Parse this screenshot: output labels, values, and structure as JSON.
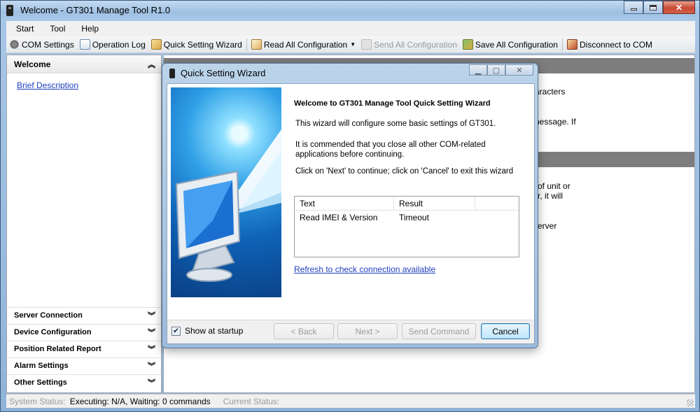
{
  "window": {
    "title": "Welcome - GT301 Manage Tool R1.0"
  },
  "menu": [
    "Start",
    "Tool",
    "Help"
  ],
  "toolbar": {
    "com_settings": "COM Settings",
    "operation_log": "Operation Log",
    "quick_setting_wizard": "Quick Setting Wizard",
    "read_all": "Read All Configuration",
    "send_all": "Send All Configuration",
    "save_all": "Save All Configuration",
    "disconnect": "Disconnect to COM"
  },
  "sidebar": {
    "header": "Welcome",
    "link": "Brief Description",
    "sections": [
      "Server Connection",
      "Device Configuration",
      "Position Related Report",
      "Alarm Settings",
      "Other Settings"
    ]
  },
  "background_text": {
    "line1": "aracters",
    "line2": "nessage. If",
    "line3": "of unit or",
    "line4": "r, it will",
    "line5": "erver"
  },
  "dialog": {
    "title": "Quick Setting Wizard",
    "heading": "Welcome to GT301 Manage Tool  Quick Setting Wizard",
    "p1": "This wizard will configure some basic settings of GT301.",
    "p2": "It is commended that you close all other COM-related applications before continuing.",
    "p3": "Click on 'Next' to continue; click on 'Cancel' to exit this wizard",
    "table": {
      "headers": [
        "Text",
        "Result"
      ],
      "rows": [
        [
          "Read IMEI & Version",
          "Timeout"
        ]
      ]
    },
    "refresh_link": "Refresh to check connection available",
    "show_at_startup": "Show at startup",
    "buttons": {
      "back": "< Back",
      "next": "Next >",
      "send": "Send Command",
      "cancel": "Cancel"
    }
  },
  "status": {
    "system_label": "System Status:",
    "executing": "Executing: N/A, Waiting: 0 commands",
    "current_label": "Current Status:"
  }
}
